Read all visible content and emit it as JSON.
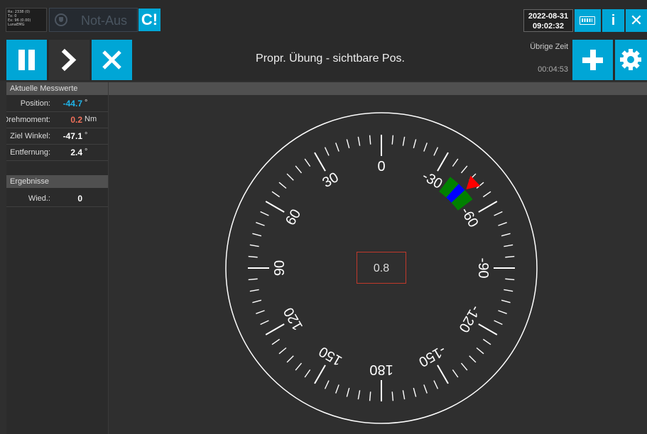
{
  "topbar": {
    "diag_lines": [
      "Rx: 2338 (0)",
      "Tx: 0",
      "Ex: 96 (0.00)",
      "LunaEMG"
    ],
    "estop_label": "Not-Aus",
    "magnet_icon": "C!",
    "date": "2022-08-31",
    "time": "09:02:32",
    "info_label": "i",
    "close_label": "✕"
  },
  "toolbar": {
    "title": "Propr. Übung - sichtbare Pos.",
    "remaining_label": "Übrige Zeit",
    "remaining_value": "00:04:53"
  },
  "sidebar": {
    "section1": "Aktuelle Messwerte",
    "rows": [
      {
        "label": "Position:",
        "value": "-44.7",
        "unit": "°",
        "color": "#1fb3e8"
      },
      {
        "label": "Drehmoment:",
        "value": "0.2",
        "unit": "Nm",
        "color": "#f0705a"
      },
      {
        "label": "Ziel Winkel:",
        "value": "-47.1",
        "unit": "°",
        "color": "#ffffff"
      },
      {
        "label": "Entfernung:",
        "value": "2.4",
        "unit": "°",
        "color": "#ffffff"
      }
    ],
    "section2": "Ergebnisse",
    "result_label": "Wied.:",
    "result_value": "0"
  },
  "gauge": {
    "center_value": "0.8",
    "labels": [
      {
        "angle": 0,
        "text": "0"
      },
      {
        "angle": 30,
        "text": "30"
      },
      {
        "angle": -30,
        "text": "-30"
      },
      {
        "angle": 60,
        "text": "60"
      },
      {
        "angle": -60,
        "text": "-60"
      },
      {
        "angle": 90,
        "text": "90"
      },
      {
        "angle": -90,
        "text": "-90"
      },
      {
        "angle": 120,
        "text": "120"
      },
      {
        "angle": -120,
        "text": "-120"
      },
      {
        "angle": 150,
        "text": "150"
      },
      {
        "angle": -150,
        "text": "-150"
      },
      {
        "angle": 180,
        "text": "180"
      }
    ],
    "target_zone": {
      "from": -37,
      "to": -53,
      "color": "#008000"
    },
    "current_position": -44.7,
    "position_color": "#0000ff",
    "pointer_angle": -47.1,
    "pointer_color": "#ff0000"
  }
}
